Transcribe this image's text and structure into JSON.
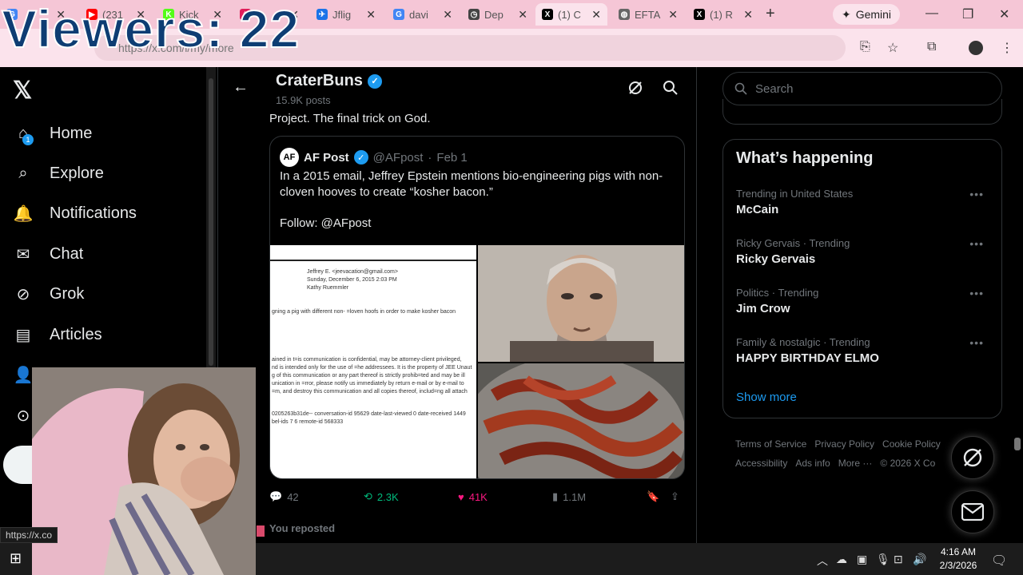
{
  "overlay": {
    "viewers": "Viewers: 22"
  },
  "browser": {
    "tabs": [
      {
        "icon": "google-icon",
        "title": "",
        "color": "#4285f4"
      },
      {
        "icon": "youtube-icon",
        "title": "(231",
        "color": "#ff0000"
      },
      {
        "icon": "kick-icon",
        "title": "Kick",
        "color": "#53fc18"
      },
      {
        "icon": "slack-icon",
        "title": "",
        "color": "#e01e5a"
      },
      {
        "icon": "flight-icon",
        "title": "Jflig",
        "color": "#1a73e8"
      },
      {
        "icon": "google-icon",
        "title": "davi",
        "color": "#4285f4"
      },
      {
        "icon": "clock-icon",
        "title": "Dep",
        "color": "#444444"
      },
      {
        "icon": "x-icon",
        "title": "(1) C",
        "color": "#000000"
      },
      {
        "icon": "globe-icon",
        "title": "EFTA",
        "color": "#666666"
      },
      {
        "icon": "x-icon",
        "title": "(1) R",
        "color": "#000000"
      }
    ],
    "gemini_label": "Gemini",
    "url": "https://x.com/i/my/more"
  },
  "leftnav": {
    "items": [
      {
        "label": "Home",
        "icon": "home-icon"
      },
      {
        "label": "Explore",
        "icon": "search-icon"
      },
      {
        "label": "Notifications",
        "icon": "bell-icon"
      },
      {
        "label": "Chat",
        "icon": "mail-icon"
      },
      {
        "label": "Grok",
        "icon": "grok-icon"
      },
      {
        "label": "Articles",
        "icon": "article-icon"
      },
      {
        "label": "Profile",
        "icon": "person-icon"
      },
      {
        "label": "More",
        "icon": "more-circle-icon"
      }
    ],
    "notification_count": "1"
  },
  "header": {
    "name": "CraterBuns",
    "posts": "15.9K posts"
  },
  "post": {
    "text": "Project. The final trick on God.",
    "quote": {
      "avatar": "AF",
      "name": "AF Post",
      "handle": "@AFpost",
      "date": "Feb 1",
      "text": "In a 2015 email, Jeffrey Epstein mentions bio-engineering pigs with non-cloven hooves to create “kosher bacon.”",
      "follow": "Follow: @AFpost",
      "doc_lines": [
        "Jeffrey E. <jeevacation@gmail.com>",
        "Sunday, December 6, 2015 2:03 PM",
        "Kathy Ruemmler",
        "gning a pig with different  non- =loven hoofs in order   to make kosher bacon",
        "ained in t=is communication is confidential, may be attorney-client privileged,",
        "nd is intended only for the use of =he addressees. It is the property of JEE Unaut",
        "g of this communication or any part thereof is strictly prohib=ted and may be ill",
        "unication in =rror, please notify us immediately by return e-mail or by e-mail to",
        "=m, and destroy this communication and all copies thereof, includ=ng all attach",
        "0205263b31de-- conversation-id 95629 date-last-viewed 0 date-received 1449",
        "bel-ids 7 6 remote-id 568333"
      ]
    },
    "stats": {
      "replies": "42",
      "reposts": "2.3K",
      "likes": "41K",
      "views": "1.1M"
    },
    "reposted_label": "You reposted"
  },
  "sidebar": {
    "search_placeholder": "Search",
    "trends_title": "What’s happening",
    "trends": [
      {
        "context": "Trending in United States",
        "name": "McCain"
      },
      {
        "context": "Ricky Gervais · Trending",
        "name": "Ricky Gervais"
      },
      {
        "context": "Politics · Trending",
        "name": "Jim Crow"
      },
      {
        "context": "Family & nostalgic · Trending",
        "name": "HAPPY BIRTHDAY ELMO"
      }
    ],
    "show_more": "Show more",
    "footer": [
      "Terms of Service",
      "Privacy Policy",
      "Cookie Policy",
      "Accessibility",
      "Ads info",
      "More ···",
      "© 2026 X Co"
    ]
  },
  "status_url": "https://x.co",
  "taskbar": {
    "time": "4:16 AM",
    "date": "2/3/2026",
    "notif_count": "1"
  },
  "colors": {
    "accent": "#1d9bf0",
    "like": "#f91880",
    "repost": "#00ba7c",
    "chrome": "#f5c6d6"
  }
}
